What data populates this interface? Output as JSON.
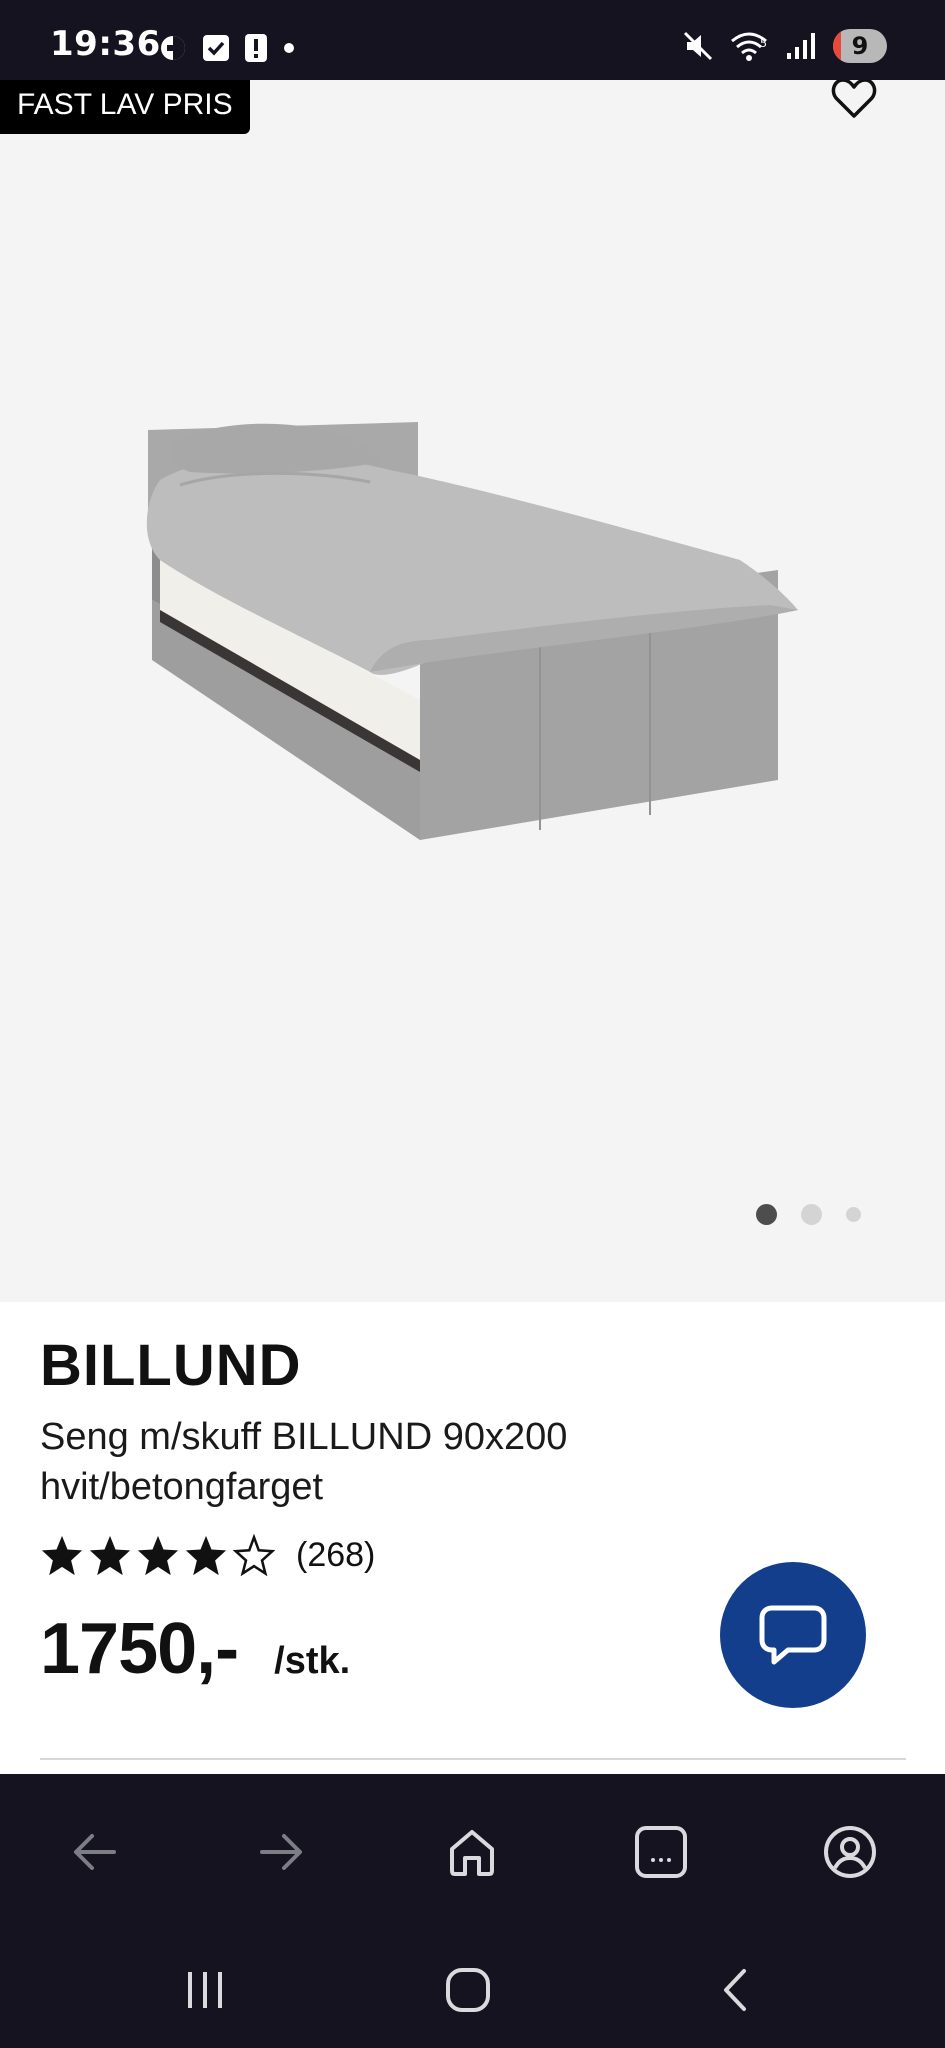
{
  "status_bar": {
    "time": "19:36",
    "battery_level": "9"
  },
  "product": {
    "badge": "FAST LAV PRIS",
    "brand": "BILLUND",
    "description": "Seng m/skuff BILLUND 90x200 hvit/betongfarget",
    "rating": 4,
    "rating_max": 5,
    "review_count": "(268)",
    "price": "1750,-",
    "unit": "/stk."
  },
  "carousel": {
    "total": 3,
    "active_index": 0
  },
  "colors": {
    "status_bg": "#14131f",
    "image_bg": "#f4f4f4",
    "chat_button": "#123e8c",
    "badge_bg": "#000000"
  },
  "icons": {
    "favorite": "heart-icon",
    "chat": "chat-bubble-icon",
    "back": "arrow-left-icon",
    "forward": "arrow-right-icon",
    "home": "home-icon",
    "tabs": "tabs-icon",
    "profile": "profile-icon"
  }
}
